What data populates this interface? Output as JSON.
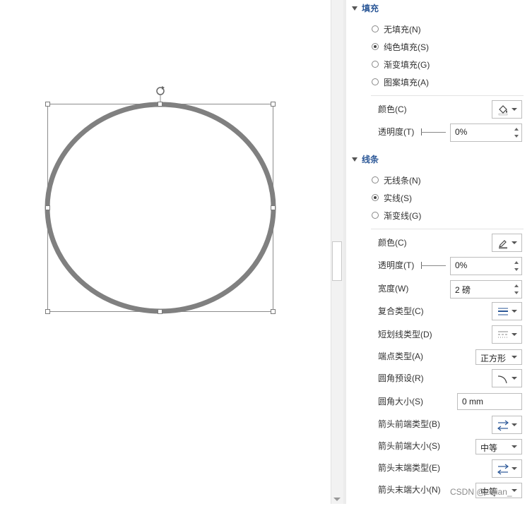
{
  "fill": {
    "title": "填充",
    "options": [
      "无填充(N)",
      "纯色填充(S)",
      "渐变填充(G)",
      "图案填充(A)"
    ],
    "selected_index": 1,
    "color_label": "颜色(C)",
    "transparency_label": "透明度(T)",
    "transparency_value": "0%"
  },
  "line": {
    "title": "线条",
    "options": [
      "无线条(N)",
      "实线(S)",
      "渐变线(G)"
    ],
    "selected_index": 1,
    "color_label": "颜色(C)",
    "transparency_label": "透明度(T)",
    "transparency_value": "0%",
    "width_label": "宽度(W)",
    "width_value": "2 磅",
    "compound_label": "复合类型(C)",
    "dash_label": "短划线类型(D)",
    "cap_label": "端点类型(A)",
    "cap_value": "正方形",
    "corner_preset_label": "圆角预设(R)",
    "corner_size_label": "圆角大小(S)",
    "corner_size_value": "0 mm",
    "arrow_begin_type_label": "箭头前端类型(B)",
    "arrow_begin_size_label": "箭头前端大小(S)",
    "arrow_begin_size_value": "中等",
    "arrow_end_type_label": "箭头末端类型(E)",
    "arrow_end_size_label": "箭头末端大小(N)",
    "arrow_end_size_value": "中等"
  },
  "watermark": "CSDN @zhjian_",
  "colors": {
    "shape_outline": "#808080",
    "section_title": "#2b5797",
    "fill_swatch": "#ffffff",
    "line_swatch": "#808080"
  },
  "icons": {
    "rotate_handle": "rotate-icon",
    "fill_color": "paint-bucket-icon",
    "line_color": "pen-color-icon",
    "compound": "compound-lines-icon",
    "dash": "dash-lines-icon",
    "corner": "corner-icon",
    "arrow": "arrow-lines-icon"
  }
}
